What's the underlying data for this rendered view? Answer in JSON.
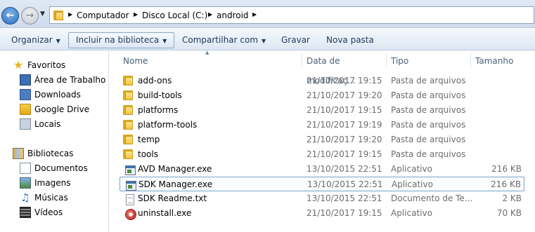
{
  "address": {
    "crumbs": [
      "Computador",
      "Disco Local (C:)",
      "android"
    ]
  },
  "toolbar": {
    "organize": "Organizar",
    "include": "Incluir na biblioteca",
    "share": "Compartilhar com",
    "burn": "Gravar",
    "new_folder": "Nova pasta"
  },
  "nav": {
    "favorites": "Favoritos",
    "desktop": "Área de Trabalho",
    "downloads": "Downloads",
    "gdrive": "Google Drive",
    "places": "Locais",
    "libraries": "Bibliotecas",
    "documents": "Documentos",
    "images": "Imagens",
    "music": "Músicas",
    "videos": "Vídeos"
  },
  "columns": {
    "name": "Nome",
    "date": "Data de modificaç...",
    "type": "Tipo",
    "size": "Tamanho"
  },
  "files": [
    {
      "name": "add-ons",
      "date": "21/10/2017 19:15",
      "type": "Pasta de arquivos",
      "size": "",
      "icon": "folder-icon"
    },
    {
      "name": "build-tools",
      "date": "21/10/2017 19:20",
      "type": "Pasta de arquivos",
      "size": "",
      "icon": "folder-icon"
    },
    {
      "name": "platforms",
      "date": "21/10/2017 19:15",
      "type": "Pasta de arquivos",
      "size": "",
      "icon": "folder-icon"
    },
    {
      "name": "platform-tools",
      "date": "21/10/2017 19:19",
      "type": "Pasta de arquivos",
      "size": "",
      "icon": "folder-icon"
    },
    {
      "name": "temp",
      "date": "21/10/2017 19:20",
      "type": "Pasta de arquivos",
      "size": "",
      "icon": "folder-icon"
    },
    {
      "name": "tools",
      "date": "21/10/2017 19:15",
      "type": "Pasta de arquivos",
      "size": "",
      "icon": "folder-icon"
    },
    {
      "name": "AVD Manager.exe",
      "date": "13/10/2015 22:51",
      "type": "Aplicativo",
      "size": "216 KB",
      "icon": "application-icon"
    },
    {
      "name": "SDK Manager.exe",
      "date": "13/10/2015 22:51",
      "type": "Aplicativo",
      "size": "216 KB",
      "icon": "application-icon"
    },
    {
      "name": "SDK Readme.txt",
      "date": "13/10/2015 22:51",
      "type": "Documento de Te...",
      "size": "2 KB",
      "icon": "text-file-icon"
    },
    {
      "name": "uninstall.exe",
      "date": "21/10/2017 19:15",
      "type": "Aplicativo",
      "size": "70 KB",
      "icon": "uninstaller-icon"
    }
  ]
}
